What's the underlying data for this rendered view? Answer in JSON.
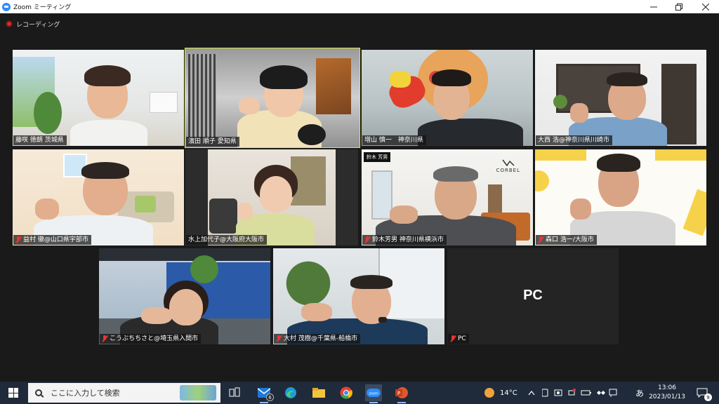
{
  "window": {
    "title": "Zoom ミーティング",
    "controls": [
      "minimize-icon",
      "maximize-icon",
      "close-icon"
    ]
  },
  "recording": {
    "label": "レコーディング"
  },
  "participants": [
    {
      "name": "藤咲 徳朗 茨城県",
      "muted": false,
      "active": false
    },
    {
      "name": "濱田 順子 愛知県",
      "muted": false,
      "active": true
    },
    {
      "name": "増山 慎一　神奈川県",
      "muted": false,
      "active": false
    },
    {
      "name": "大西 浩@神奈川県川崎市",
      "muted": false,
      "active": false
    },
    {
      "name": "益村 徹@山口県宇部市",
      "muted": true,
      "active": false
    },
    {
      "name": "水上加代子@大阪府大阪市",
      "muted": false,
      "active": false
    },
    {
      "name": "鈴木芳男 神奈川県横浜市",
      "muted": true,
      "active": false,
      "tag": "鈴木 芳男",
      "logo": "CORBEL"
    },
    {
      "name": "森口 浩一/大阪市",
      "muted": true,
      "active": false
    },
    {
      "name": "こうぶちちさと@埼玉県入間市",
      "muted": true,
      "active": false
    },
    {
      "name": "大村 茂樹@千葉県-船橋市",
      "muted": true,
      "active": false
    },
    {
      "name": "PC",
      "muted": true,
      "active": false,
      "video_off": true,
      "display_name": "PC"
    }
  ],
  "taskbar": {
    "search_placeholder": "ここに入力して検索",
    "mail_badge": "6",
    "weather": "14°C",
    "ime": "あ",
    "time": "13:06",
    "date": "2023/01/13",
    "notifications": "9",
    "apps": [
      "task-view-icon",
      "mail-icon",
      "edge-icon",
      "file-explorer-icon",
      "chrome-icon",
      "zoom-icon",
      "powerpoint-icon"
    ]
  }
}
